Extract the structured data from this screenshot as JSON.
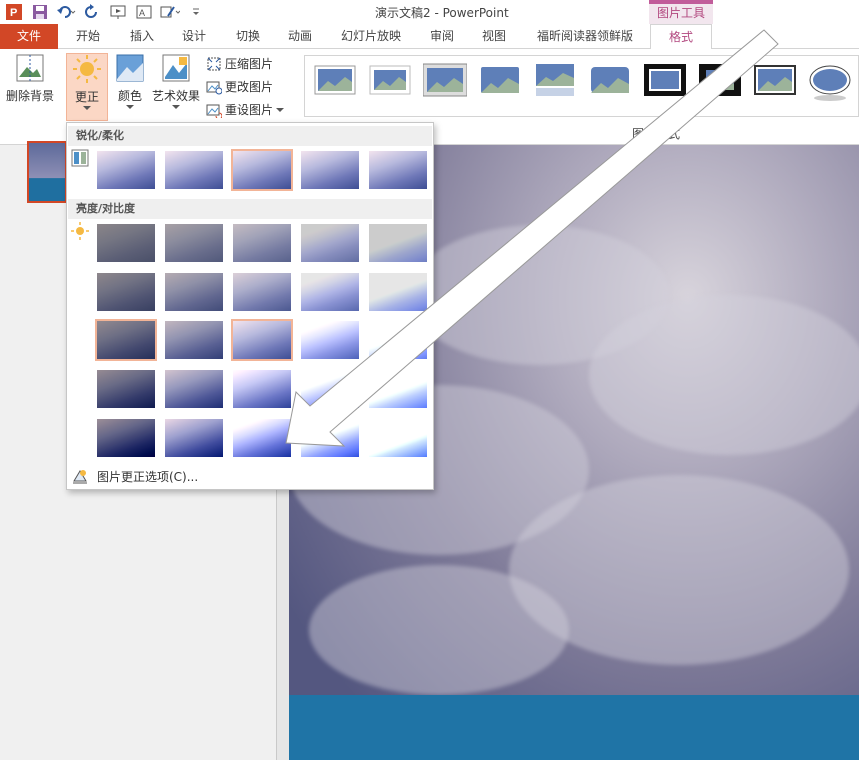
{
  "window": {
    "title": "演示文稿2 - PowerPoint",
    "context_tab_group": "图片工具"
  },
  "tabs": [
    {
      "label": "文件"
    },
    {
      "label": "开始"
    },
    {
      "label": "插入"
    },
    {
      "label": "设计"
    },
    {
      "label": "切换"
    },
    {
      "label": "动画"
    },
    {
      "label": "幻灯片放映"
    },
    {
      "label": "审阅"
    },
    {
      "label": "视图"
    },
    {
      "label": "福昕阅读器领鲜版"
    },
    {
      "label": "格式"
    }
  ],
  "ribbon": {
    "remove_background": "删除背景",
    "corrections": "更正",
    "color": "颜色",
    "artistic_effects": "艺术效果",
    "compress": "压缩图片",
    "change_picture": "更改图片",
    "reset_picture": "重设图片",
    "picture_styles_label": "图片样式"
  },
  "corrections_menu": {
    "section_sharpen": "锐化/柔化",
    "section_brightness": "亮度/对比度",
    "options_link": "图片更正选项(C)..."
  },
  "colors": {
    "accent": "#d24726",
    "context": "#b2487f",
    "highlight": "#f2b497"
  }
}
